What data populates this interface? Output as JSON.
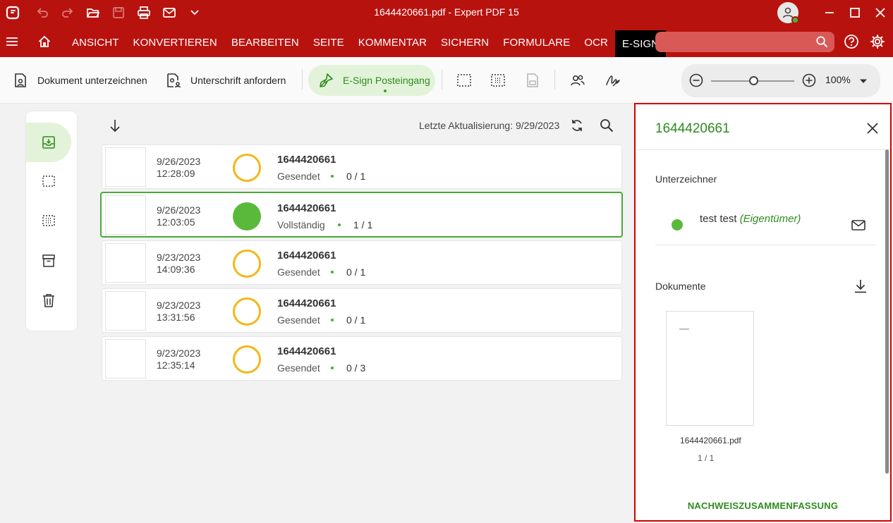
{
  "window": {
    "title": "1644420661.pdf   -   Expert PDF 15"
  },
  "menu": {
    "items": [
      "ANSICHT",
      "KONVERTIEREN",
      "BEARBEITEN",
      "SEITE",
      "KOMMENTAR",
      "SICHERN",
      "FORMULARE",
      "OCR",
      "E-SIGN"
    ],
    "active": "E-SIGN",
    "search_value": ""
  },
  "toolbar": {
    "sign_document": "Dokument unterzeichnen",
    "request_signature": "Unterschrift anfordern",
    "inbox": "E-Sign Posteingang",
    "zoom": "100%"
  },
  "list": {
    "last_update": "Letzte Aktualisierung: 9/29/2023",
    "rows": [
      {
        "date": "9/26/2023",
        "time": "12:28:09",
        "title": "1644420661",
        "status": "Gesendet",
        "count": "0 / 1",
        "complete": false
      },
      {
        "date": "9/26/2023",
        "time": "12:03:05",
        "title": "1644420661",
        "status": "Vollständig",
        "count": "1 / 1",
        "complete": true
      },
      {
        "date": "9/23/2023",
        "time": "14:09:36",
        "title": "1644420661",
        "status": "Gesendet",
        "count": "0 / 1",
        "complete": false
      },
      {
        "date": "9/23/2023",
        "time": "13:31:56",
        "title": "1644420661",
        "status": "Gesendet",
        "count": "0 / 1",
        "complete": false
      },
      {
        "date": "9/23/2023",
        "time": "12:35:14",
        "title": "1644420661",
        "status": "Gesendet",
        "count": "0 / 3",
        "complete": false
      }
    ]
  },
  "panel": {
    "title": "1644420661",
    "signers_label": "Unterzeichner",
    "signer_name": "test test",
    "signer_role": "(Eigentümer)",
    "documents_label": "Dokumente",
    "doc_name": "1644420661.pdf",
    "doc_pages": "1 / 1",
    "summary": "NACHWEISZUSAMMENFASSUNG"
  },
  "colors": {
    "brand_red": "#b8120f",
    "accent_green": "#2e8b1e",
    "pending_yellow": "#f2b81a",
    "complete_green": "#5ab93b"
  }
}
